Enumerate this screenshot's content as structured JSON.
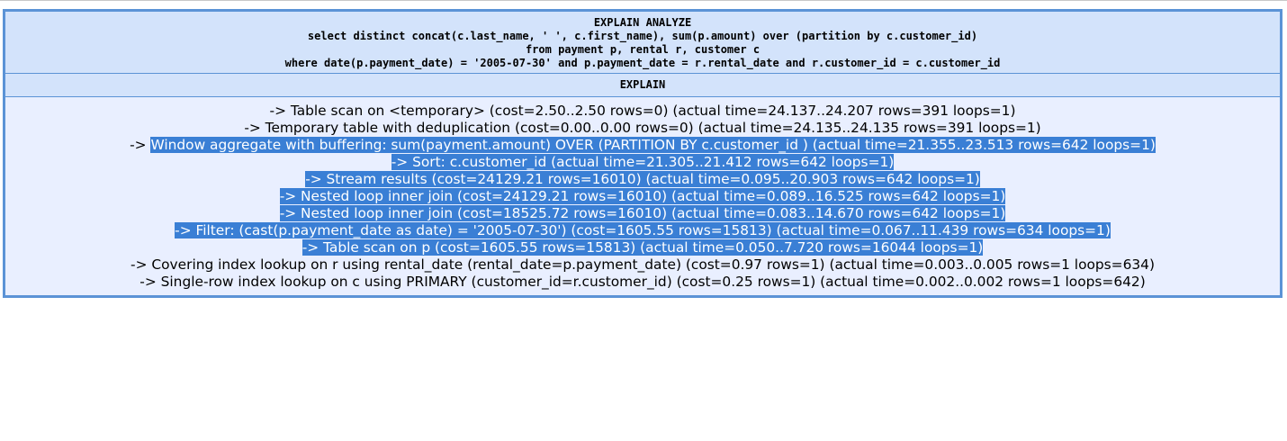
{
  "query": {
    "lines": [
      "EXPLAIN ANALYZE",
      "select distinct concat(c.last_name, ' ', c.first_name), sum(p.amount) over (partition by c.customer_id)",
      "from payment p, rental r, customer c",
      "where date(p.payment_date) = '2005-07-30' and p.payment_date = r.rental_date and r.customer_id = c.customer_id"
    ]
  },
  "result": {
    "column_header": "EXPLAIN",
    "plan_lines": [
      {
        "prefix": "-> Table scan on <temporary> (cost=2.50..2.50 rows=0) (actual time=24.137..24.207 rows=391 loops=1)",
        "selected": ""
      },
      {
        "prefix": "-> Temporary table with deduplication (cost=0.00..0.00 rows=0) (actual time=24.135..24.135 rows=391 loops=1)",
        "selected": ""
      },
      {
        "prefix": "-> ",
        "selected": "Window aggregate with buffering: sum(payment.amount) OVER (PARTITION BY c.customer_id ) (actual time=21.355..23.513 rows=642 loops=1)"
      },
      {
        "prefix": "",
        "selected": "-> Sort: c.customer_id (actual time=21.305..21.412 rows=642 loops=1)"
      },
      {
        "prefix": "",
        "selected": "-> Stream results (cost=24129.21 rows=16010) (actual time=0.095..20.903 rows=642 loops=1)"
      },
      {
        "prefix": "",
        "selected": "-> Nested loop inner join (cost=24129.21 rows=16010) (actual time=0.089..16.525 rows=642 loops=1)"
      },
      {
        "prefix": "",
        "selected": "-> Nested loop inner join (cost=18525.72 rows=16010) (actual time=0.083..14.670 rows=642 loops=1)"
      },
      {
        "prefix": "",
        "selected": "-> Filter: (cast(p.payment_date as date) = '2005-07-30') (cost=1605.55 rows=15813) (actual time=0.067..11.439 rows=634 loops=1)"
      },
      {
        "prefix": "",
        "selected": "-> Table scan on p (cost=1605.55 rows=15813) (actual time=0.050..7.720 rows=16044 loops=1)"
      },
      {
        "prefix": "-> Covering index lookup on r using rental_date (rental_date=p.payment_date) (cost=0.97 rows=1) (actual time=0.003..0.005 rows=1 loops=634)",
        "selected": ""
      },
      {
        "prefix": "-> Single-row index lookup on c using PRIMARY (customer_id=r.customer_id) (cost=0.25 rows=1) (actual time=0.002..0.002 rows=1 loops=642)",
        "selected": ""
      }
    ]
  },
  "colors": {
    "border": "#5b93d6",
    "header_bg": "#d3e3fb",
    "body_bg": "#e9efff",
    "selection_bg": "#3a7fd5"
  }
}
